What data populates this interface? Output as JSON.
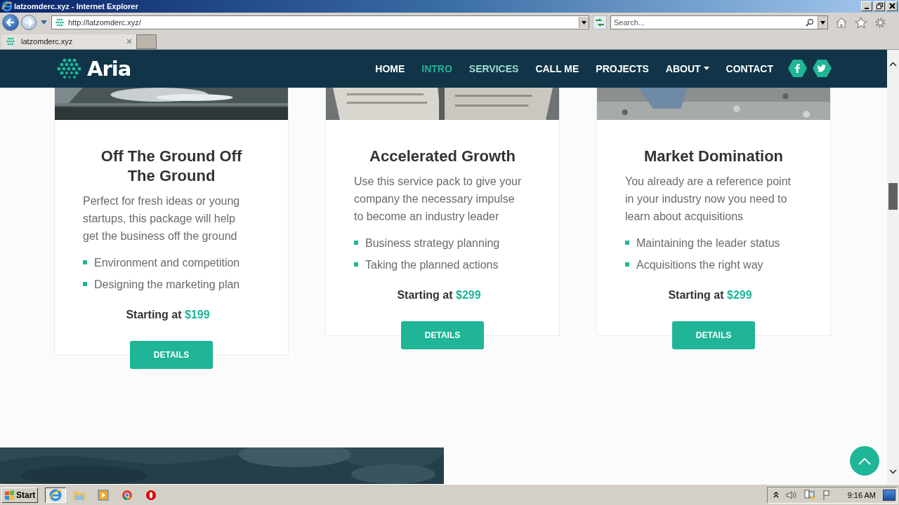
{
  "window": {
    "title": "latzomderc.xyz - Internet Explorer"
  },
  "address_bar": {
    "url": "http://latzomderc.xyz/"
  },
  "search": {
    "placeholder": "Search..."
  },
  "tabs": [
    {
      "label": "latzomderc.xyz",
      "selected": true
    }
  ],
  "site_nav": {
    "logo": "Aria",
    "items": [
      {
        "label": "HOME",
        "selected": false,
        "hovered": false,
        "dropdown": false
      },
      {
        "label": "INTRO",
        "selected": true,
        "hovered": false,
        "dropdown": false
      },
      {
        "label": "SERVICES",
        "selected": false,
        "hovered": true,
        "dropdown": false
      },
      {
        "label": "CALL ME",
        "selected": false,
        "hovered": false,
        "dropdown": false
      },
      {
        "label": "PROJECTS",
        "selected": false,
        "hovered": false,
        "dropdown": false
      },
      {
        "label": "ABOUT",
        "selected": false,
        "hovered": false,
        "dropdown": true
      },
      {
        "label": "CONTACT",
        "selected": false,
        "hovered": false,
        "dropdown": false
      }
    ],
    "social": [
      {
        "kind": "facebook"
      },
      {
        "kind": "twitter"
      }
    ]
  },
  "cards": [
    {
      "title": "Off The Ground Off The Ground",
      "text": "Perfect for fresh ideas or young startups, this package will help get the business off the ground",
      "features": [
        "Environment and competition",
        "Designing the marketing plan"
      ],
      "price_label": "Starting at",
      "price": "$199",
      "button": "DETAILS"
    },
    {
      "title": "Accelerated Growth",
      "text": "Use this service pack to give your company the necessary impulse to become an industry leader",
      "features": [
        "Business strategy planning",
        "Taking the planned actions"
      ],
      "price_label": "Starting at",
      "price": "$299",
      "button": "DETAILS"
    },
    {
      "title": "Market Domination",
      "text": "You already are a reference point in your industry now you need to learn about acquisitions",
      "features": [
        "Maintaining the leader status",
        "Acquisitions the right way"
      ],
      "price_label": "Starting at",
      "price": "$299",
      "button": "DETAILS"
    }
  ],
  "taskbar": {
    "start": "Start",
    "clock": "9:16 AM",
    "apps": [
      {
        "kind": "ie",
        "selected": true
      },
      {
        "kind": "folder",
        "selected": false
      },
      {
        "kind": "media",
        "selected": false
      },
      {
        "kind": "chrome",
        "selected": false
      },
      {
        "kind": "opera",
        "selected": false
      }
    ]
  }
}
